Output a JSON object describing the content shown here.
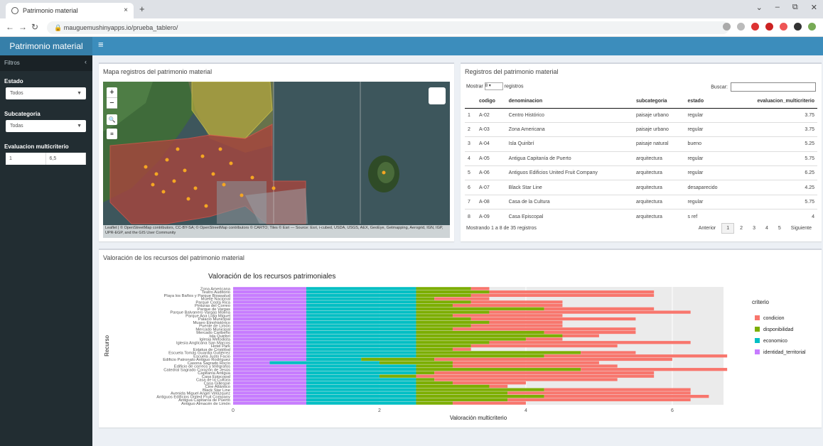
{
  "browser": {
    "tab_title": "Patrimonio material",
    "tab_close": "×",
    "new_tab": "+",
    "url": "mauguemushinyapps.io/prueba_tablero/",
    "window_controls": [
      "⌄",
      "–",
      "⧉",
      "✕"
    ]
  },
  "app": {
    "title": "Patrimonio material",
    "menu_icon": "≡"
  },
  "sidebar": {
    "header": "Filtros",
    "collapse": "‹",
    "estado_label": "Estado",
    "estado_value": "Todos",
    "subcategoria_label": "Subcategoria",
    "subcategoria_value": "Todas",
    "evaluacion_label": "Evaluacion multicriterio",
    "evaluacion_min": "1",
    "evaluacion_max": "6,5"
  },
  "map_box": {
    "title": "Mapa registros del patrimonio material",
    "zoom_in": "+",
    "zoom_out": "−",
    "search": "🔍",
    "fullscreen": "⌗",
    "attribution": "Leaflet | © OpenStreetMap contributors, CC-BY-SA; © OpenStreetMap contributors © CARTO; Tiles © Esri — Source: Esri, i-cubed, USDA, USGS, AEX, GeoEye, Getmapping, Aerogrid, IGN, IGP, UPR-EGP, and the GIS User Community"
  },
  "table_box": {
    "title": "Registros del patrimonio material",
    "show_prefix": "Mostrar",
    "show_value": "8",
    "show_suffix": "registros",
    "search_label": "Buscar:",
    "columns": [
      "",
      "codigo",
      "denominacion",
      "subcategoria",
      "estado",
      "evaluacion_multicriterio"
    ],
    "rows": [
      [
        "1",
        "A-02",
        "Centro Histórico",
        "paisaje urbano",
        "regular",
        "3.75"
      ],
      [
        "2",
        "A-03",
        "Zona Americana",
        "paisaje urbano",
        "regular",
        "3.75"
      ],
      [
        "3",
        "A-04",
        "Isla Quiribrí",
        "paisaje natural",
        "bueno",
        "5.25"
      ],
      [
        "4",
        "A-05",
        "Antigua Capitanía de Puerto",
        "arquitectura",
        "regular",
        "5.75"
      ],
      [
        "5",
        "A-06",
        "Antiguos Edificios United Fruit Company",
        "arquitectura",
        "regular",
        "6.25"
      ],
      [
        "6",
        "A-07",
        "Black Star Line",
        "arquitectura",
        "desaparecido",
        "4.25"
      ],
      [
        "7",
        "A-08",
        "Casa de la Cultura",
        "arquitectura",
        "regular",
        "5.75"
      ],
      [
        "8",
        "A-09",
        "Casa Episcopal",
        "arquitectura",
        "s ref",
        "4"
      ]
    ],
    "info": "Mostrando 1 a 8 de 35 registros",
    "prev": "Anterior",
    "pages": [
      "1",
      "2",
      "3",
      "4",
      "5"
    ],
    "next": "Siguiente"
  },
  "chart_box": {
    "title": "Valoración de los recursos del patrimonio material"
  },
  "chart_data": {
    "type": "bar",
    "orientation": "horizontal",
    "stacked": true,
    "title": "Valoración de los recursos patrimoniales",
    "xlabel": "Valoración multicriterio",
    "ylabel": "Recurso",
    "xlim": [
      0,
      6.7
    ],
    "xticks": [
      0,
      2,
      4,
      6
    ],
    "grid": true,
    "legend_title": "criterio",
    "legend_position": "right",
    "colors": {
      "condicion": "#f8766d",
      "disponibilidad": "#7cae00",
      "economico": "#00bfc4",
      "identidad_territorial": "#c77cff"
    },
    "categories": [
      "Zona Americana",
      "Teatro Auditorio",
      "Playa los Baños y Parque Bioasalud",
      "Muelle Nacional",
      "Parque Costa Rica",
      "Pinturas del Correo",
      "Parque de Vargas",
      "Parque Balvanero Vargas Molina",
      "Parque Ana Lidia Miguel",
      "Palacio Municipal",
      "Museo Etnohistórico",
      "Puente de Limón",
      "Mercado Municipal",
      "Mercado Caribeño",
      "Isla Quiribrí",
      "Iglesia Metodista",
      "Iglesia Anglicana San Marcos",
      "Hotel Park",
      "Estatua de Cristóbal",
      "Escuela Tomás Guardia Gutiérrez",
      "Escuela Justo Facio",
      "Edificio Patronato Antiguo Rodríguez",
      "Casona Sagrado Rocío",
      "Edificio de correos y telégrafos",
      "Catedral Sagrado Corazón de Jesús",
      "Capitanía Antigua",
      "Casa Episcopal",
      "Casa de la Cultura",
      "Casa Gillespie",
      "Cine Atlántico",
      "Black Star Line",
      "Avenida Miguel Angel Velázquez",
      "Antiguos Edificios United Fruit Company",
      "Antigua Capitanía de Puerto",
      "Antiguo Almacén de Limón"
    ],
    "series": [
      {
        "name": "identidad_territorial",
        "values": [
          1,
          1,
          1,
          1,
          1,
          1,
          1,
          1,
          1,
          1,
          1,
          1,
          1,
          1,
          1,
          1,
          1,
          1,
          1,
          1,
          1,
          1,
          0.5,
          1,
          1,
          1,
          1,
          1,
          1,
          1,
          1,
          1,
          1,
          1,
          1
        ]
      },
      {
        "name": "economico",
        "values": [
          1.5,
          1.5,
          1.5,
          1.5,
          1.5,
          1.5,
          1.5,
          1.5,
          1.5,
          1.5,
          1.5,
          1.5,
          1.5,
          1.5,
          1.5,
          1.5,
          1.5,
          1.5,
          1.5,
          1.5,
          1.5,
          0.75,
          1.5,
          1.5,
          1.5,
          1.5,
          1.0,
          1.5,
          1.5,
          1.5,
          1.5,
          1.5,
          1.5,
          1.5,
          1.5
        ]
      },
      {
        "name": "disponibilidad",
        "values": [
          0.75,
          1.0,
          0.75,
          0.25,
          0.75,
          0.5,
          1.75,
          1.0,
          0.5,
          0.75,
          1.0,
          0.75,
          0.5,
          1.75,
          2.0,
          1.5,
          1.0,
          0.75,
          0.5,
          2.25,
          1.75,
          1.0,
          1.0,
          0.5,
          2.25,
          0.25,
          0.5,
          0.25,
          0.5,
          1.0,
          1.75,
          1.25,
          1.75,
          1.25,
          0.5
        ]
      },
      {
        "name": "condicion",
        "values": [
          0.25,
          2.25,
          2.5,
          0.75,
          1.25,
          1.5,
          1.5,
          2.75,
          1.5,
          2.25,
          1.0,
          1.25,
          2.5,
          1.25,
          0.5,
          0.5,
          2.75,
          2.0,
          0.25,
          0.75,
          2.5,
          3.25,
          2.0,
          2.25,
          2.0,
          3.0,
          3.25,
          2.5,
          1.0,
          0.25,
          2.0,
          2.5,
          2.25,
          2.5,
          1.0
        ]
      }
    ]
  }
}
